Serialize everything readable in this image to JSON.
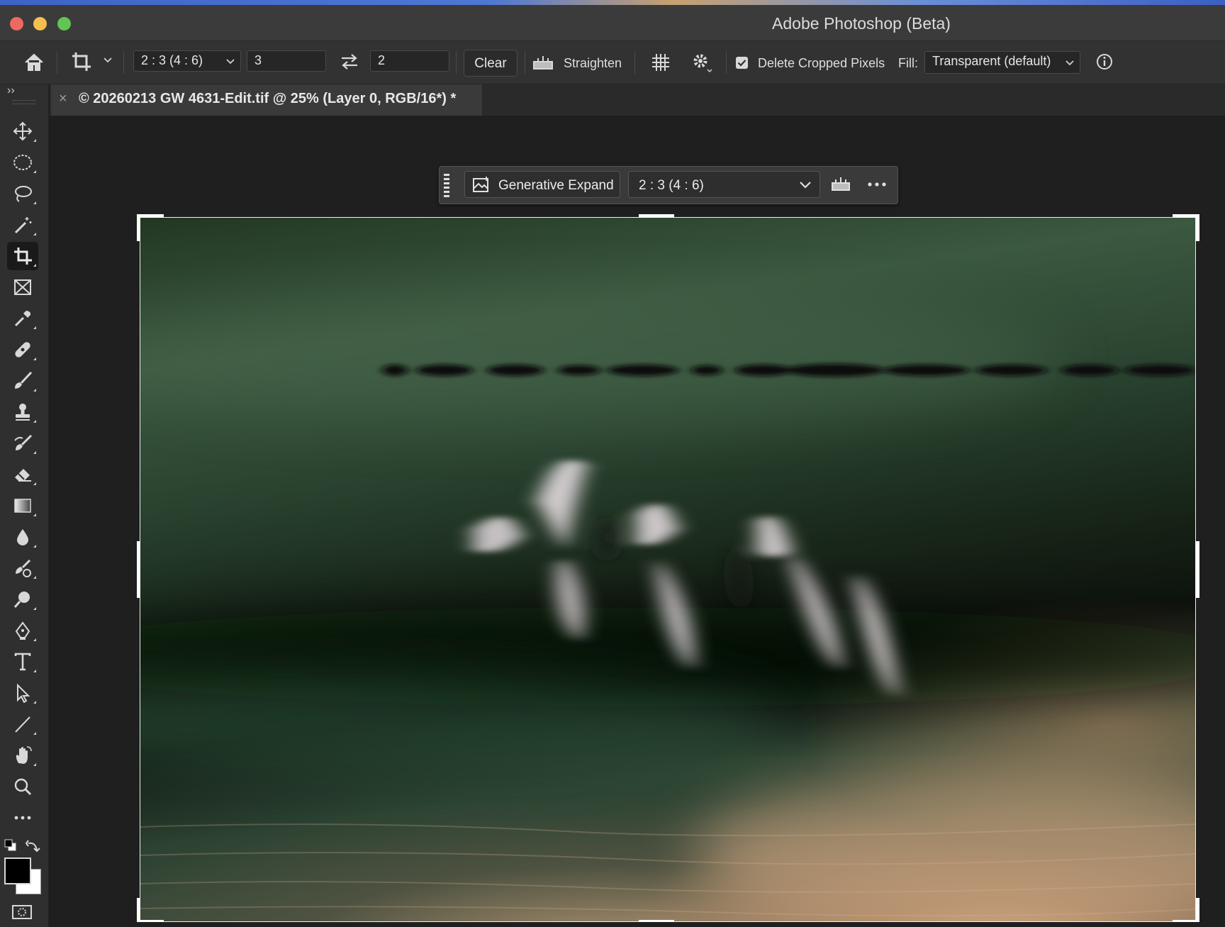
{
  "app": {
    "title": "Adobe Photoshop (Beta)"
  },
  "colors": {
    "window_bg": "#1e1e1e",
    "panel": "#2f2f2f",
    "optbar": "#323232",
    "accent_close": "#ed6a5e",
    "accent_min": "#f5bf4f",
    "accent_max": "#61c554"
  },
  "options_bar": {
    "ratio_preset": "2 : 3 (4 : 6)",
    "width_value": "3",
    "height_value": "2",
    "clear_label": "Clear",
    "straighten_label": "Straighten",
    "delete_cropped_label": "Delete Cropped Pixels",
    "delete_cropped_checked": true,
    "fill_label": "Fill:",
    "fill_value": "Transparent (default)",
    "icons": [
      "home-icon",
      "crop-tool-icon",
      "swap-icon",
      "straighten-icon",
      "grid-overlay-icon",
      "settings-icon",
      "info-icon"
    ]
  },
  "document": {
    "tab_title": "© 20260213 GW 4631-Edit.tif @ 25% (Layer 0, RGB/16*) *",
    "close_glyph": "×"
  },
  "toolbar": {
    "expand_glyph": "››",
    "tools": [
      "move-tool-icon",
      "elliptical-marquee-icon",
      "lasso-icon",
      "magic-wand-icon",
      "crop-icon",
      "frame-icon",
      "eyedropper-icon",
      "healing-brush-icon",
      "brush-icon",
      "clone-stamp-icon",
      "history-brush-icon",
      "eraser-icon",
      "gradient-icon",
      "blur-icon",
      "dodge-icon",
      "burn-icon",
      "pen-icon",
      "type-icon",
      "path-selection-icon",
      "line-icon",
      "hand-icon",
      "zoom-icon",
      "more-tools-icon"
    ],
    "active_tool": "crop-icon",
    "foreground_color": "#000000",
    "background_color": "#ffffff"
  },
  "context_bar": {
    "generative_expand_label": "Generative Expand",
    "ratio_value": "2 : 3 (4 : 6)",
    "icons": [
      "drag-handle-icon",
      "generative-expand-icon",
      "chevron-down-icon",
      "straighten-icon",
      "more-icon"
    ]
  }
}
